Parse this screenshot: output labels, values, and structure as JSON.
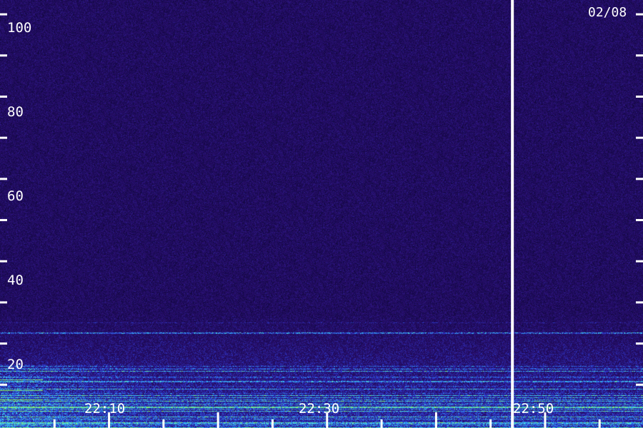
{
  "date_label": "02/08",
  "chart_data": {
    "type": "heatmap",
    "title": "",
    "xlabel": "",
    "ylabel": "",
    "x_tick_labels": [
      "22:10",
      "22:30",
      "22:50"
    ],
    "y_tick_labels": [
      "20",
      "40",
      "60",
      "80",
      "100"
    ],
    "ylim": [
      0,
      104
    ],
    "x_minutes_range": [
      22.0,
      22.983
    ],
    "x_labeled_ticks_hours": [
      22.167,
      22.5,
      22.833
    ],
    "x_minor_tick_step_minutes": 5,
    "y_minor_tick_step": 10,
    "event_marker_time": "22:47",
    "colors": {
      "background": "#2a0f6e",
      "low": "#1a0a55",
      "mid": "#2d3cd6",
      "high": "#36d2ff",
      "peak": "#8cff66",
      "marker": "#ffffff",
      "text": "#ffffff"
    }
  }
}
